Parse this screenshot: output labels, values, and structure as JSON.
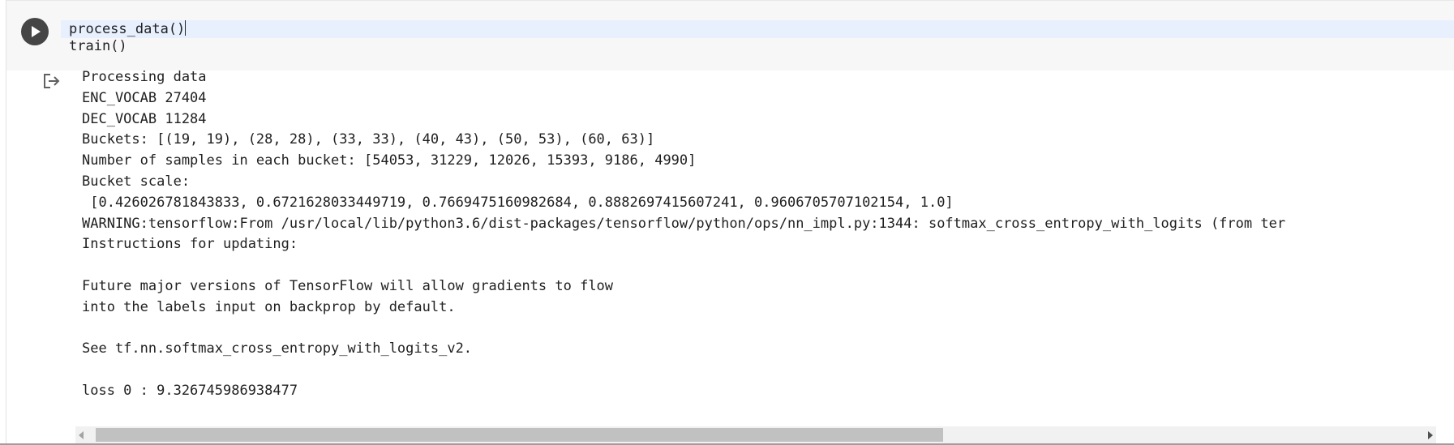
{
  "cell": {
    "code_lines": [
      "process_data()",
      "train()"
    ]
  },
  "output": {
    "lines": [
      "Processing data",
      "ENC_VOCAB 27404",
      "DEC_VOCAB 11284",
      "Buckets: [(19, 19), (28, 28), (33, 33), (40, 43), (50, 53), (60, 63)]",
      "Number of samples in each bucket: [54053, 31229, 12026, 15393, 9186, 4990]",
      "Bucket scale:",
      " [0.426026781843833, 0.6721628033449719, 0.7669475160982684, 0.8882697415607241, 0.9606705707102154, 1.0]",
      "WARNING:tensorflow:From /usr/local/lib/python3.6/dist-packages/tensorflow/python/ops/nn_impl.py:1344: softmax_cross_entropy_with_logits (from ter",
      "Instructions for updating:",
      "",
      "Future major versions of TensorFlow will allow gradients to flow",
      "into the labels input on backprop by default.",
      "",
      "See tf.nn.softmax_cross_entropy_with_logits_v2.",
      "",
      "loss 0 : 9.326745986938477"
    ]
  },
  "icons": {
    "run": "play-icon",
    "output": "output-redirect-icon"
  },
  "colors": {
    "run_button": "#454545",
    "active_line": "#e8f0fe",
    "cell_background": "#f7f7f7",
    "scroll_thumb": "#c1c1c1"
  }
}
